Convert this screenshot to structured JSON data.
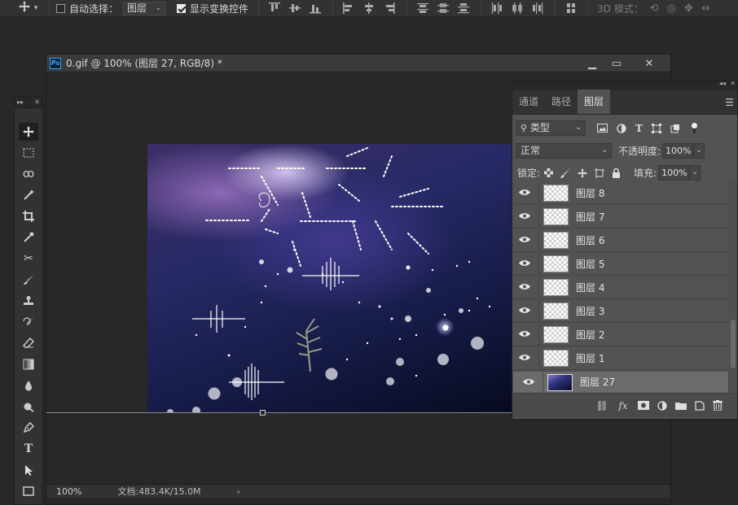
{
  "options_bar": {
    "auto_select_label": "自动选择：",
    "auto_select_value": "图层",
    "show_transform_label": "显示变换控件",
    "mode_3d_label": "3D 模式："
  },
  "document": {
    "title": "0.gif @ 100% (图层 27, RGB/8) *",
    "ps_badge": "Ps",
    "zoom": "100%",
    "doc_info": "文档:483.4K/15.0M",
    "status_arrow": "›"
  },
  "layers_panel": {
    "tabs": [
      "通道",
      "路径",
      "图层"
    ],
    "active_tab": "图层",
    "filter_kind": "类型",
    "blend_mode": "正常",
    "opacity_label": "不透明度:",
    "opacity_value": "100%",
    "lock_label": "锁定:",
    "fill_label": "填充:",
    "fill_value": "100%",
    "layers": [
      {
        "name": "图层 8",
        "thumb": "transparent",
        "selected": false
      },
      {
        "name": "图层 7",
        "thumb": "transparent",
        "selected": false
      },
      {
        "name": "图层 6",
        "thumb": "transparent",
        "selected": false
      },
      {
        "name": "图层 5",
        "thumb": "transparent",
        "selected": false
      },
      {
        "name": "图层 4",
        "thumb": "transparent",
        "selected": false
      },
      {
        "name": "图层 3",
        "thumb": "transparent",
        "selected": false
      },
      {
        "name": "图层 2",
        "thumb": "transparent",
        "selected": false
      },
      {
        "name": "图层 1",
        "thumb": "transparent",
        "selected": false
      },
      {
        "name": "图层 27",
        "thumb": "image",
        "selected": true
      }
    ],
    "footer_fx_label": "fx"
  },
  "toolbar": {
    "tools": [
      "move-tool",
      "marquee-tool",
      "lasso-tool",
      "magic-wand-tool",
      "crop-tool",
      "eyedropper-tool",
      "healing-tool",
      "brush-tool",
      "stamp-tool",
      "history-brush-tool",
      "eraser-tool",
      "gradient-tool",
      "blur-tool",
      "dodge-tool",
      "pen-tool",
      "type-tool",
      "path-select-tool",
      "rectangle-tool"
    ],
    "type_tool_glyph": "T"
  },
  "colors": {
    "ps_blue": "#31a8ff",
    "panel_bg": "#535353",
    "app_bg": "#282828"
  }
}
